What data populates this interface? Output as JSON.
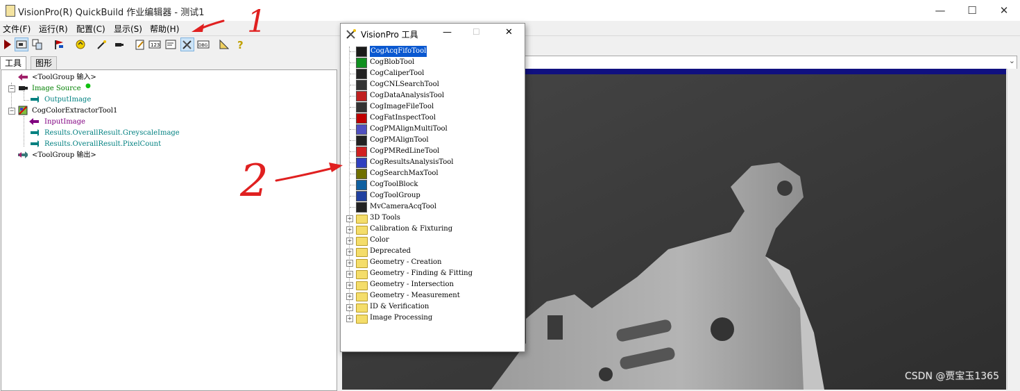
{
  "window": {
    "title": "VisionPro(R) QuickBuild 作业编辑器 - 测试1",
    "minimize_glyph": "—",
    "maximize_glyph": "☐",
    "close_glyph": "✕"
  },
  "menu": [
    "文件(F)",
    "运行(R)",
    "配置(C)",
    "显示(S)",
    "帮助(H)"
  ],
  "toolbar": {
    "buttons": [
      "run-icon",
      "show-image-icon",
      "copy-icon",
      "flag-icon",
      "refresh-icon",
      "wand-icon",
      "camera-icon",
      "edit-icon",
      "numbers-icon",
      "terminal-icon",
      "tools-icon",
      "log-icon",
      "measure-icon",
      "help-icon"
    ],
    "pressed": [
      "show-image-icon",
      "tools-icon"
    ]
  },
  "left_tabs": [
    "工具",
    "图形"
  ],
  "tree": {
    "group_input": "<ToolGroup 输入>",
    "image_source": "Image Source",
    "output_image": "OutputImage",
    "extractor": "CogColorExtractorTool1",
    "input_image": "InputImage",
    "greyscale": "Results.OverallResult.GreyscaleImage",
    "pixel_count": "Results.OverallResult.PixelCount",
    "group_output": "<ToolGroup 输出>"
  },
  "palette": {
    "title": "VisionPro 工具",
    "tools": [
      "CogAcqFifoTool",
      "CogBlobTool",
      "CogCaliperTool",
      "CogCNLSearchTool",
      "CogDataAnalysisTool",
      "CogImageFileTool",
      "CogFatInspectTool",
      "CogPMAlignMultiTool",
      "CogPMAlignTool",
      "CogPMRedLineTool",
      "CogResultsAnalysisTool",
      "CogSearchMaxTool",
      "CogToolBlock",
      "CogToolGroup",
      "MvCameraAcqTool"
    ],
    "selected": "CogAcqFifoTool",
    "folders": [
      "3D Tools",
      "Calibration & Fixturing",
      "Color",
      "Deprecated",
      "Geometry - Creation",
      "Geometry - Finding & Fitting",
      "Geometry - Intersection",
      "Geometry - Measurement",
      "ID & Verification",
      "Image Processing"
    ]
  },
  "annotations": {
    "label_1": "1",
    "label_2": "2",
    "color": "#e02020"
  },
  "watermark": "CSDN @贾宝玉1365",
  "colors": {
    "teal": "#008080",
    "purple": "#800080",
    "selection": "#0a58d0",
    "image_strip": "#101080"
  }
}
